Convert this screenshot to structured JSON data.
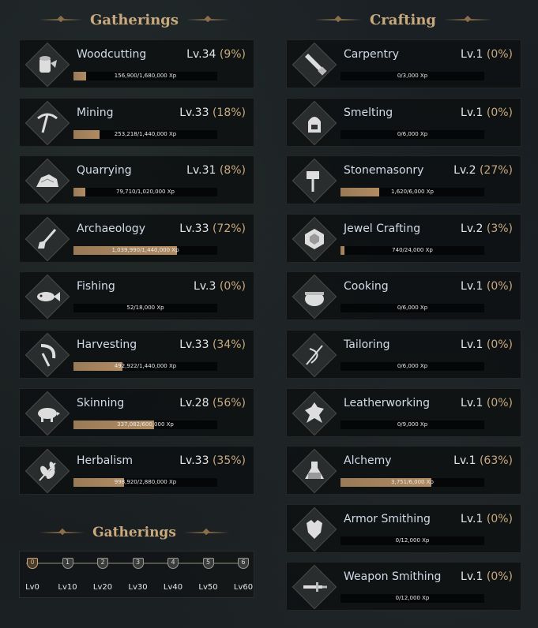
{
  "titles": {
    "gatherings": "Gatherings",
    "crafting": "Crafting",
    "gatherings_milestones": "Gatherings"
  },
  "gatherings": [
    {
      "name": "Woodcutting",
      "level": "Lv.34",
      "pct": "(9%)",
      "xp": "156,900/1,680,000 Xp",
      "progress": 0.09,
      "icon": "log-icon"
    },
    {
      "name": "Mining",
      "level": "Lv.33",
      "pct": "(18%)",
      "xp": "253,218/1,440,000 Xp",
      "progress": 0.18,
      "icon": "pickaxe-icon"
    },
    {
      "name": "Quarrying",
      "level": "Lv.31",
      "pct": "(8%)",
      "xp": "79,710/1,020,000 Xp",
      "progress": 0.08,
      "icon": "boulder-icon"
    },
    {
      "name": "Archaeology",
      "level": "Lv.33",
      "pct": "(72%)",
      "xp": "1,039,990/1,440,000 Xp",
      "progress": 0.72,
      "icon": "shovel-icon"
    },
    {
      "name": "Fishing",
      "level": "Lv.3",
      "pct": "(0%)",
      "xp": "52/18,000 Xp",
      "progress": 0.0,
      "icon": "fish-icon"
    },
    {
      "name": "Harvesting",
      "level": "Lv.33",
      "pct": "(34%)",
      "xp": "492,922/1,440,000 Xp",
      "progress": 0.34,
      "icon": "sickle-icon"
    },
    {
      "name": "Skinning",
      "level": "Lv.28",
      "pct": "(56%)",
      "xp": "337,082/600,000 Xp",
      "progress": 0.56,
      "icon": "boar-icon"
    },
    {
      "name": "Herbalism",
      "level": "Lv.33",
      "pct": "(35%)",
      "xp": "998,920/2,880,000 Xp",
      "progress": 0.35,
      "icon": "leaf-icon"
    }
  ],
  "crafting": [
    {
      "name": "Carpentry",
      "level": "Lv.1",
      "pct": "(0%)",
      "xp": "0/3,000 Xp",
      "progress": 0.0,
      "icon": "saw-icon"
    },
    {
      "name": "Smelting",
      "level": "Lv.1",
      "pct": "(0%)",
      "xp": "0/6,000 Xp",
      "progress": 0.0,
      "icon": "furnace-icon"
    },
    {
      "name": "Stonemasonry",
      "level": "Lv.2",
      "pct": "(27%)",
      "xp": "1,620/6,000 Xp",
      "progress": 0.27,
      "icon": "hammer-icon"
    },
    {
      "name": "Jewel Crafting",
      "level": "Lv.2",
      "pct": "(3%)",
      "xp": "740/24,000 Xp",
      "progress": 0.03,
      "icon": "gem-icon"
    },
    {
      "name": "Cooking",
      "level": "Lv.1",
      "pct": "(0%)",
      "xp": "0/6,000 Xp",
      "progress": 0.0,
      "icon": "cauldron-icon"
    },
    {
      "name": "Tailoring",
      "level": "Lv.1",
      "pct": "(0%)",
      "xp": "0/6,000 Xp",
      "progress": 0.0,
      "icon": "needle-icon"
    },
    {
      "name": "Leatherworking",
      "level": "Lv.1",
      "pct": "(0%)",
      "xp": "0/9,000 Xp",
      "progress": 0.0,
      "icon": "hide-icon"
    },
    {
      "name": "Alchemy",
      "level": "Lv.1",
      "pct": "(63%)",
      "xp": "3,751/6,000 Xp",
      "progress": 0.63,
      "icon": "flask-icon"
    },
    {
      "name": "Armor Smithing",
      "level": "Lv.1",
      "pct": "(0%)",
      "xp": "0/12,000 Xp",
      "progress": 0.0,
      "icon": "armor-icon"
    },
    {
      "name": "Weapon Smithing",
      "level": "Lv.1",
      "pct": "(0%)",
      "xp": "0/12,000 Xp",
      "progress": 0.0,
      "icon": "sword-icon"
    }
  ],
  "milestones": [
    {
      "num": "0",
      "label": "Lv0",
      "active": true
    },
    {
      "num": "1",
      "label": "Lv10",
      "active": false
    },
    {
      "num": "2",
      "label": "Lv20",
      "active": false
    },
    {
      "num": "3",
      "label": "Lv30",
      "active": false
    },
    {
      "num": "4",
      "label": "Lv40",
      "active": false
    },
    {
      "num": "5",
      "label": "Lv50",
      "active": false
    },
    {
      "num": "6",
      "label": "Lv60",
      "active": false
    }
  ],
  "colors": {
    "accent": "#c9aa7e",
    "name": "#d2dbe8",
    "fill": "#a5825c",
    "card": "#0d1012"
  }
}
